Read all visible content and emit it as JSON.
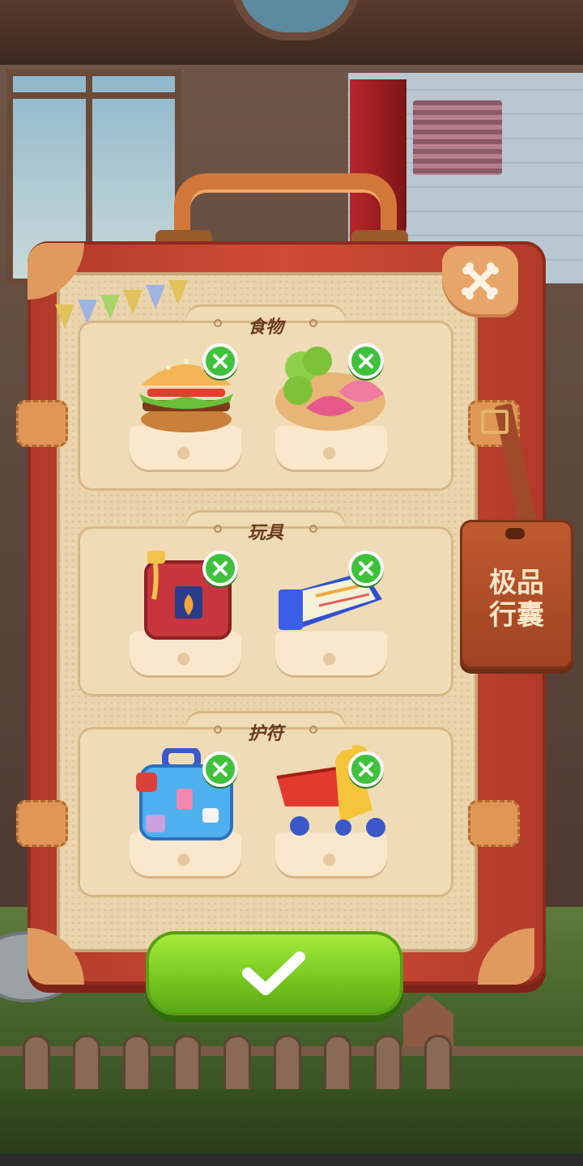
{
  "sections": [
    {
      "title": "食物",
      "items": [
        {
          "icon": "hamburger-icon"
        },
        {
          "icon": "dumplings-icon"
        }
      ]
    },
    {
      "title": "玩具",
      "items": [
        {
          "icon": "fuel-can-icon"
        },
        {
          "icon": "ticket-icon"
        }
      ]
    },
    {
      "title": "护符",
      "items": [
        {
          "icon": "suitcase-icon"
        },
        {
          "icon": "shopping-cart-icon"
        }
      ]
    }
  ],
  "tag": {
    "line1": "极品",
    "line2": "行囊"
  },
  "colors": {
    "confirm": "#74c51e",
    "remove": "#3fc13c",
    "case": "#cf4c36"
  }
}
